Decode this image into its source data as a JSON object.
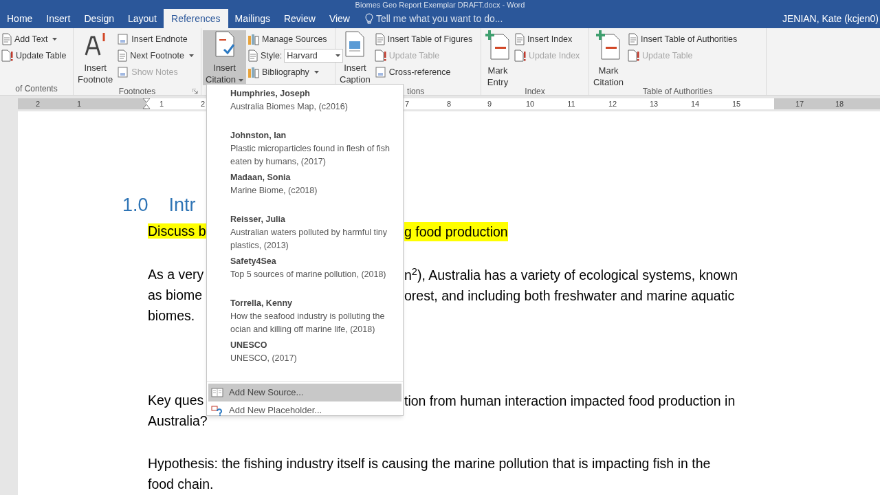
{
  "title_bar": {
    "title": "Biomes Geo Report Exemplar DRAFT.docx - Word"
  },
  "tabs": [
    {
      "label": "Home",
      "selected": false
    },
    {
      "label": "Insert",
      "selected": false
    },
    {
      "label": "Design",
      "selected": false
    },
    {
      "label": "Layout",
      "selected": false
    },
    {
      "label": "References",
      "selected": true
    },
    {
      "label": "Mailings",
      "selected": false
    },
    {
      "label": "Review",
      "selected": false
    },
    {
      "label": "View",
      "selected": false
    }
  ],
  "tell_me": {
    "placeholder": "Tell me what you want to do..."
  },
  "user": "JENIAN, Kate (kcjen0)",
  "ribbon": {
    "groups": [
      {
        "label": "of Contents",
        "items": [
          {
            "kind": "small",
            "label": "Add Text",
            "dropdown": true,
            "disabled": false
          },
          {
            "kind": "small",
            "label": "Update Table",
            "dropdown": false,
            "disabled": false
          }
        ]
      },
      {
        "label": "Footnotes",
        "launcher": true,
        "items": [
          {
            "kind": "large",
            "label": "Insert Footnote",
            "dropdown": false,
            "disabled": false
          },
          {
            "kind": "small",
            "label": "Insert Endnote",
            "dropdown": false,
            "disabled": false
          },
          {
            "kind": "small",
            "label": "Next Footnote",
            "dropdown": true,
            "disabled": false
          },
          {
            "kind": "small",
            "label": "Show Notes",
            "dropdown": false,
            "disabled": true
          }
        ]
      },
      {
        "items": [
          {
            "kind": "large",
            "label": "Insert Citation",
            "dropdown": true,
            "disabled": false,
            "selected": true
          },
          {
            "kind": "small",
            "label": "Manage Sources",
            "dropdown": false,
            "disabled": false
          },
          {
            "kind": "combo",
            "label": "Style:",
            "value": "Harvard",
            "disabled": false
          },
          {
            "kind": "small",
            "label": "Bibliography",
            "dropdown": true,
            "disabled": false
          }
        ]
      },
      {
        "label": "tions",
        "items": [
          {
            "kind": "large",
            "label": "Insert Caption",
            "dropdown": false,
            "disabled": false
          },
          {
            "kind": "small",
            "label": "Insert Table of Figures",
            "dropdown": false,
            "disabled": false
          },
          {
            "kind": "small",
            "label": "Update Table",
            "dropdown": false,
            "disabled": true
          },
          {
            "kind": "small",
            "label": "Cross-reference",
            "dropdown": false,
            "disabled": false
          }
        ]
      },
      {
        "label": "Index",
        "items": [
          {
            "kind": "large",
            "label": "Mark Entry",
            "dropdown": false,
            "disabled": false
          },
          {
            "kind": "small",
            "label": "Insert Index",
            "dropdown": false,
            "disabled": false
          },
          {
            "kind": "small",
            "label": "Update Index",
            "dropdown": false,
            "disabled": true
          }
        ]
      },
      {
        "label": "Table of Authorities",
        "items": [
          {
            "kind": "large",
            "label": "Mark Citation",
            "dropdown": false,
            "disabled": false
          },
          {
            "kind": "small",
            "label": "Insert Table of Authorities",
            "dropdown": false,
            "disabled": false
          },
          {
            "kind": "small",
            "label": "Update Table",
            "dropdown": false,
            "disabled": true
          }
        ]
      }
    ]
  },
  "ruler": {
    "numbers": [
      "2",
      "1",
      "1",
      "2",
      "7",
      "8",
      "9",
      "10",
      "11",
      "12",
      "13",
      "14",
      "15",
      "17",
      "18"
    ]
  },
  "document": {
    "paragraphs": [
      {
        "kind": "heading",
        "lines": [
          {
            "left": "1.0    Intr"
          }
        ]
      },
      {
        "kind": "highlight",
        "lines": [
          {
            "left": "Discuss b",
            "right": "g food production"
          }
        ]
      },
      {
        "kind": "body",
        "lines": [
          {
            "left": "As a very",
            "right": "n$^{2}$), Australia has a variety of ecological systems, known"
          },
          {
            "left": "as biome",
            "right": "orest, and including both freshwater and marine aquatic"
          },
          {
            "left": "biomes."
          }
        ]
      },
      {
        "kind": "body",
        "lines": [
          {
            "left": "Key ques",
            "right": "tion from human interaction impacted food production in"
          },
          {
            "left": "Australia?"
          }
        ]
      },
      {
        "kind": "body",
        "lines": [
          {
            "left": "Hypothesis: the fishing industry itself is causing the marine pollution that is impacting fish in the"
          },
          {
            "left": "food chain."
          }
        ]
      }
    ]
  },
  "citation_menu": {
    "sources": [
      {
        "author": "Humphries, Joseph",
        "title": "Australia Biomes Map, (c2016)"
      },
      {
        "author": "Johnston, Ian",
        "title": "Plastic microparticles found in flesh of fish eaten by humans, (2017)"
      },
      {
        "author": "Madaan, Sonia",
        "title": "Marine Biome, (c2018)"
      },
      {
        "author": "Reisser, Julia",
        "title": "Australian waters polluted by harmful tiny plastics, (2013)"
      },
      {
        "author": "Safety4Sea",
        "title": "Top 5 sources of marine pollution, (2018)"
      },
      {
        "author": "Torrella, Kenny",
        "title": "How the seafood industry is polluting the ocian and killing off marine life, (2018)"
      },
      {
        "author": "UNESCO",
        "title": "UNESCO, (2017)"
      }
    ],
    "actions": [
      {
        "label": "Add New Source...",
        "selected": true
      },
      {
        "label": "Add New Placeholder...",
        "selected": false
      }
    ]
  }
}
